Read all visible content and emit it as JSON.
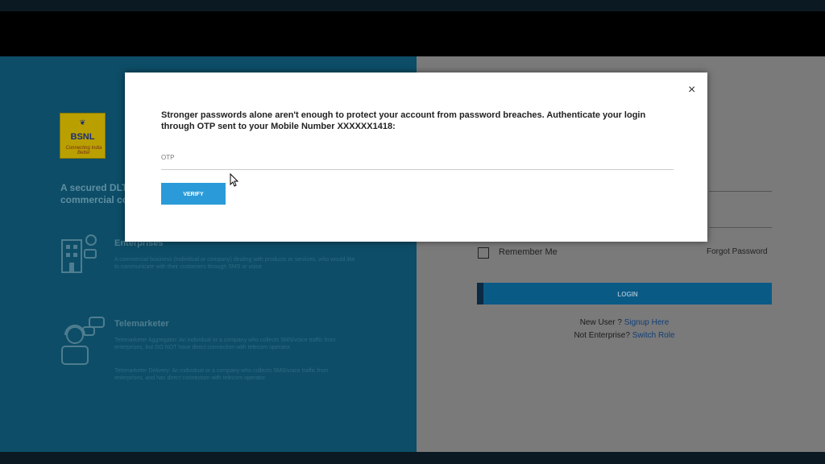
{
  "left": {
    "logo_top": "❦",
    "logo_text": "BSNL",
    "logo_tagline": "Connecting India Better",
    "intro": "A secured DLT commercial co",
    "categories": [
      {
        "title": "Enterprises",
        "desc": "A commercial business (individual or company) dealing with products or services, who would like to communicate with their customers through SMS or voice"
      },
      {
        "title": "Telemarketer",
        "desc1": "Telemarketer Aggregator: An individual or a company who collects SMS/voice traffic from enterprises, but DO NOT have direct connection with telecom operator.",
        "desc2": "Telemarketer Delivery: An individual or a company who collects SMS/voice traffic from enterprises, and has direct connection with telecom operator."
      }
    ]
  },
  "right": {
    "remember_label": "Remember Me",
    "forgot_label": "Forgot Password",
    "login_label": "LOGIN",
    "new_user_text": "New User ?",
    "signup_link": "Signup Here",
    "not_enterprise_text": "Not Enterprise?",
    "switch_role_link": "Switch Role"
  },
  "modal": {
    "close_label": "×",
    "message": "Stronger passwords alone aren't enough to protect your account from password breaches. Authenticate your login through OTP sent to your Mobile Number XXXXXX1418:",
    "otp_label": "OTP",
    "otp_value": "",
    "verify_label": "VERIFY"
  },
  "colors": {
    "left_panel": "#0d4d67",
    "right_panel": "#7a7a7a",
    "login_button": "#0a5a86",
    "verify_button": "#2a9bd8"
  }
}
